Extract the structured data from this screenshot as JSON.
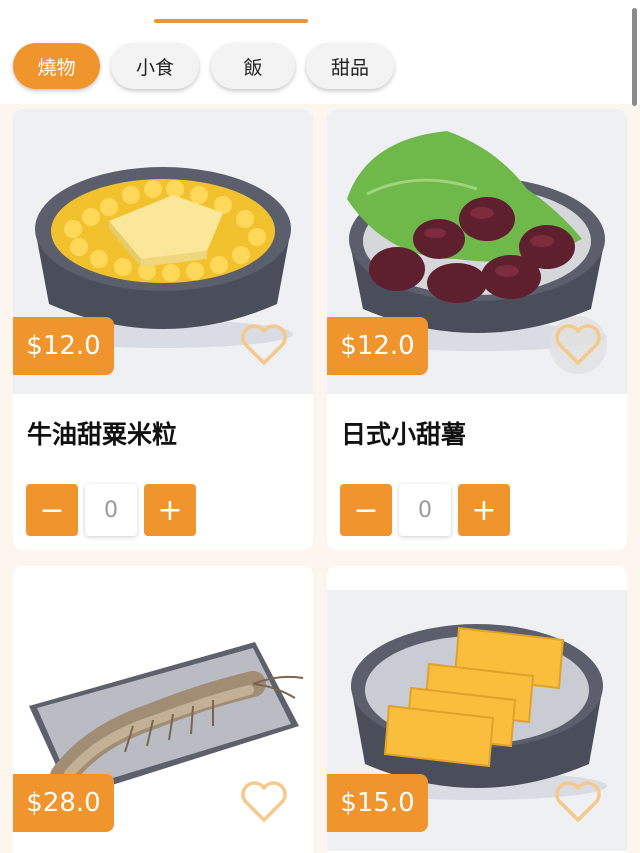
{
  "tabs": [
    {
      "label": "燒物",
      "active": true
    },
    {
      "label": "小食",
      "active": false
    },
    {
      "label": "飯",
      "active": false
    },
    {
      "label": "甜品",
      "active": false
    }
  ],
  "colors": {
    "accent": "#f0942e",
    "heart": "#f5c98b"
  },
  "icons": {
    "favorite": "heart-outline-icon",
    "decrease": "minus-icon",
    "increase": "plus-icon"
  },
  "products": [
    {
      "name": "牛油甜粟米粒",
      "price": "$12.0",
      "quantity": "0",
      "decrease_label": "−",
      "increase_label": "+"
    },
    {
      "name": "日式小甜薯",
      "price": "$12.0",
      "quantity": "0",
      "decrease_label": "−",
      "increase_label": "+"
    },
    {
      "name": "",
      "price": "$28.0"
    },
    {
      "name": "",
      "price": "$15.0"
    }
  ]
}
